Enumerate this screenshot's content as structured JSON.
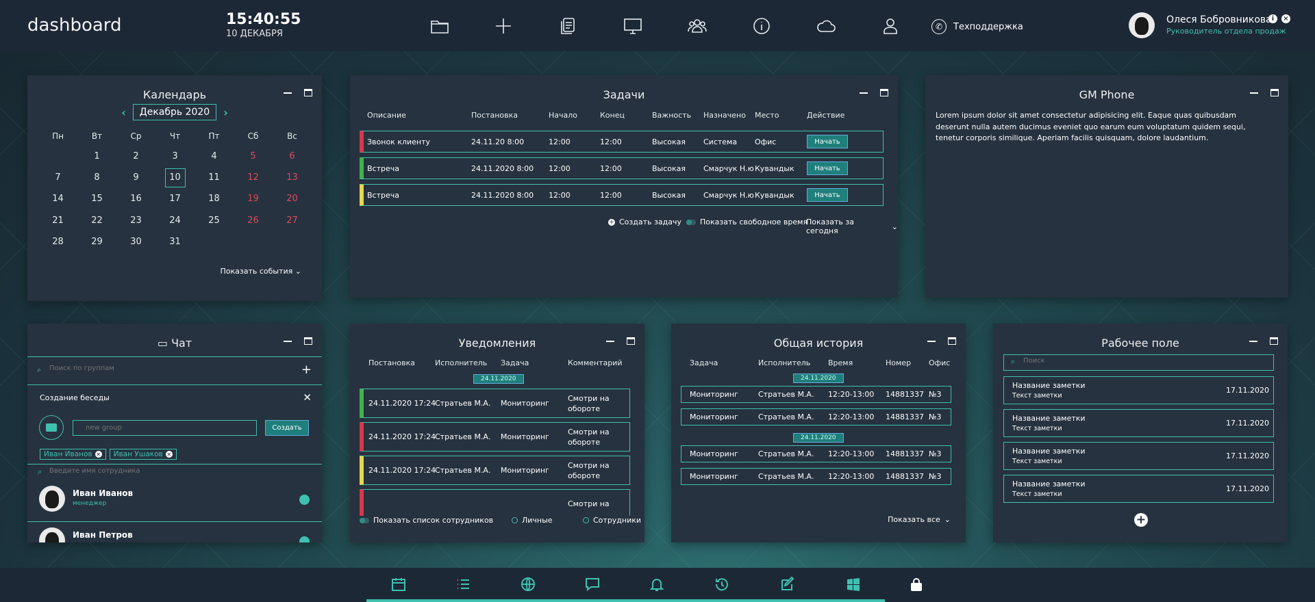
{
  "app": {
    "logo": "dashboard",
    "time": "15:40:55",
    "date": "10 ДЕКАБРЯ"
  },
  "topbar": {
    "icons": [
      "folder-icon",
      "plus-icon",
      "documents-icon",
      "monitor-icon",
      "users-icon",
      "info-icon",
      "cloud-icon",
      "profile-icon"
    ],
    "support_label": "Техподдержка",
    "user_name": "Олеся Бобровникова",
    "user_role": "Руководитель отдела продаж"
  },
  "calendar": {
    "title": "Календарь",
    "month": "Декабрь 2020",
    "weekdays": [
      "Пн",
      "Вт",
      "Ср",
      "Чт",
      "Пт",
      "Сб",
      "Вс"
    ],
    "weeks": [
      [
        "",
        "1",
        "2",
        "3",
        "4",
        "5",
        "6"
      ],
      [
        "7",
        "8",
        "9",
        "10",
        "11",
        "12",
        "13"
      ],
      [
        "14",
        "15",
        "16",
        "17",
        "18",
        "19",
        "20"
      ],
      [
        "21",
        "22",
        "23",
        "24",
        "25",
        "26",
        "27"
      ],
      [
        "28",
        "29",
        "30",
        "31",
        "",
        "",
        ""
      ]
    ],
    "today": "10",
    "show_events": "Показать события"
  },
  "tasks": {
    "title": "Задачи",
    "columns": [
      "Описание",
      "Постановка",
      "Начало",
      "Конец",
      "Важность",
      "Назначено",
      "Место",
      "Действие"
    ],
    "rows": [
      {
        "desc": "Звонок клиенту",
        "set": "24.11.20 8:00",
        "start": "12:00",
        "end": "12:00",
        "importance": "Высокая",
        "assigned": "Система",
        "place": "Офис",
        "action": "Начать",
        "color": "#d8374b"
      },
      {
        "desc": "Встреча",
        "set": "24.11.2020 8:00",
        "start": "12:00",
        "end": "12:00",
        "importance": "Высокая",
        "assigned": "Смарчук Н.ю",
        "place": "Кувандык",
        "action": "Начать",
        "color": "#3fb44c"
      },
      {
        "desc": "Встреча",
        "set": "24.11.2020 8:00",
        "start": "12:00",
        "end": "12:00",
        "importance": "Высокая",
        "assigned": "Смарчук Н.ю",
        "place": "Кувандык",
        "action": "Начать",
        "color": "#e6d64a"
      }
    ],
    "create_task": "Создать задачу",
    "show_free_time": "Показать свободное время",
    "show_today": "Показать за сегодня"
  },
  "gmphone": {
    "title": "GM Phone",
    "text": "Lorem ipsum dolor sit amet consectetur adipisicing elit. Eaque quas quibusdam deserunt nulla autem ducimus eveniet quo earum eum voluptatum quidem sequi, tenetur corporis similique. Aperiam facilis quisquam, dolore laudantium."
  },
  "chat": {
    "title": "Чат",
    "group_search_placeholder": "Поиск по группам",
    "create_conversation": "Создание беседы",
    "group_name_placeholder": "new group",
    "create_button": "Создать",
    "tags": [
      "Иван Иванов",
      "Иван Ушаков"
    ],
    "employee_placeholder": "Введите имя сотрудника",
    "contacts": [
      {
        "name": "Иван Иванов",
        "role": "менеджер"
      },
      {
        "name": "Иван Петров",
        "role": ""
      }
    ]
  },
  "notifications": {
    "title": "Уведомления",
    "columns": [
      "Постановка",
      "Исполнитель",
      "Задача",
      "Комментарий"
    ],
    "date_chip": "24.11.2020",
    "rows": [
      {
        "set": "24.11.2020 17:24",
        "executor": "Стратьев М.А.",
        "task": "Мониторинг",
        "comment": "Смотри на обороте",
        "color": "#3fb44c"
      },
      {
        "set": "24.11.2020 17:24",
        "executor": "Стратьев М.А.",
        "task": "Мониторинг",
        "comment": "Смотри на обороте",
        "color": "#d8374b"
      },
      {
        "set": "24.11.2020 17:24",
        "executor": "Стратьев М.А.",
        "task": "Мониторинг",
        "comment": "Смотри на обороте",
        "color": "#e6d64a"
      },
      {
        "set": "",
        "executor": "",
        "task": "",
        "comment": "Смотри на",
        "color": "#d8374b"
      }
    ],
    "show_employees": "Показать список сотрудников",
    "personal": "Личные",
    "employees": "Сотрудники"
  },
  "history": {
    "title": "Общая история",
    "columns": [
      "Задача",
      "Исполнитель",
      "Время",
      "Номер",
      "Офис"
    ],
    "groups": [
      {
        "date": "24.11.2020",
        "rows": [
          {
            "task": "Мониторинг",
            "executor": "Стратьев М.А.",
            "time": "12:20-13:00",
            "number": "14881337",
            "office": "№3"
          },
          {
            "task": "Мониторинг",
            "executor": "Стратьев М.А.",
            "time": "12:20-13:00",
            "number": "14881337",
            "office": "№3"
          }
        ]
      },
      {
        "date": "24.11.2020",
        "rows": [
          {
            "task": "Мониторинг",
            "executor": "Стратьев М.А.",
            "time": "12:20-13:00",
            "number": "14881337",
            "office": "№3"
          },
          {
            "task": "Мониторинг",
            "executor": "Стратьев М.А.",
            "time": "12:20-13:00",
            "number": "14881337",
            "office": "№3"
          }
        ]
      }
    ],
    "show_all": "Показать все"
  },
  "workspace": {
    "title": "Рабочее поле",
    "search_placeholder": "Поиск",
    "notes": [
      {
        "title": "Название заметки",
        "text": "Текст заметки",
        "date": "17.11.2020"
      },
      {
        "title": "Название заметки",
        "text": "Текст заметки",
        "date": "17.11.2020"
      },
      {
        "title": "Название заметки",
        "text": "Текст заметки",
        "date": "17.11.2020"
      },
      {
        "title": "Название заметки",
        "text": "Текст заметки",
        "date": "17.11.2020"
      }
    ]
  },
  "bottombar": {
    "icons": [
      "calendar-icon",
      "list-icon",
      "globe-icon",
      "chat-icon",
      "bell-icon",
      "history-icon",
      "edit-icon",
      "windows-icon",
      "lock-icon"
    ]
  },
  "colors": {
    "accent": "#3fc1b0",
    "panel": "#26323f",
    "red": "#d8374b",
    "green": "#3fb44c",
    "yellow": "#e6d64a",
    "weekend": "#e24a5a"
  }
}
